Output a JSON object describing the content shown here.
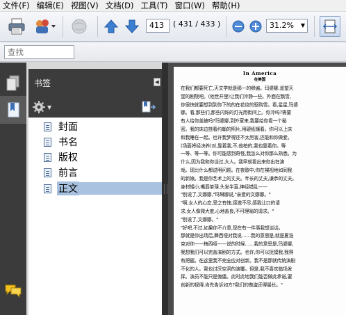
{
  "menu": [
    "文件(F)",
    "编辑(E)",
    "视图(V)",
    "文档(D)",
    "工具(T)",
    "窗口(W)",
    "帮助(H)"
  ],
  "toolbar": {
    "current_page": "413",
    "page_count": "( 431 / 433 )",
    "zoom": "31.2%"
  },
  "find": {
    "placeholder": "查找"
  },
  "bookmarks": {
    "title": "书签",
    "items": [
      {
        "label": "封面"
      },
      {
        "label": "书名"
      },
      {
        "label": "版权"
      },
      {
        "label": "前言"
      },
      {
        "label": "正文"
      }
    ],
    "selected_index": 4
  },
  "document": {
    "header_title": "In America",
    "header_sub": "在美国",
    "lines": [
      "在我们都要死亡,天文学就是那一的缈遍。玛婆娜,遥望天",
      "堂的剧院吧。(他世开里)让我们冷静一些。外面在飘雪,",
      "你很快就要想到到你下的的在花纹的驱购雪。看,星星,玛婆",
      "娜。看,那些们,那些闪烁的灯光用街间上。你冷吗?需要",
      "有人给你盖被吗?玛婆娜,到外室来,我要给你看一个秘",
      "密。我的床边挂着约翰的照片,用硬纸镶着。你可以上床",
      "和我睡在一起。也许我梦得还不太厉害,还能和你做爱。",
      "(场面将经决养)对,靠着我,不,他柏的,我也靠着你。等",
      "一等、等一等。你可能感到奇怪,我怎么对你那么熟悉。为",
      "什么,因为我和你谈过,大人。我早就看出来你出在演",
      "戏。现比什么都说明问题。在夜歌中,你在裸视地如同我",
      "的新娘。我是你艺术上的丈夫。年长的丈夫,谦恭的丈夫。",
      "身材矮小,嘴唇单薄,头发半直,神经错乱——",
      "\"别说了,文娜娜,\"玛琳娜说,\"亲爱的文娜娜。\"",
      "\"啊,女人的心恋,受之有愧,感激不尽,感我让口的请",
      "求,女人像微大度,心地善良,不可理喻的请求。\"",
      "\"别说了,文娜娜。\"",
      "\"好吧,不过,如果你不介意,现在有一件事我想谈谈。",
      "那就是你出场后,舞西哑对我说……我的意思是,就是夏浩",
      "克对你——梅西哑——说的时候……我的意思是,玛婆娜,",
      "我想我们可以完善演剧的方式。也许,你可以抚摸我,我得",
      "有把握。在这里我不完全应对创新。我不是那就传统演剧",
      "不化的人。我也讨厌空洞的演覆。但是,我不喜欢临场发",
      "挥。演员不能只是傀儡。此时此地我们能否做此承诺,要",
      "创新的视得,肯先告诉如方?我们的做盗还得最长。\""
    ]
  }
}
